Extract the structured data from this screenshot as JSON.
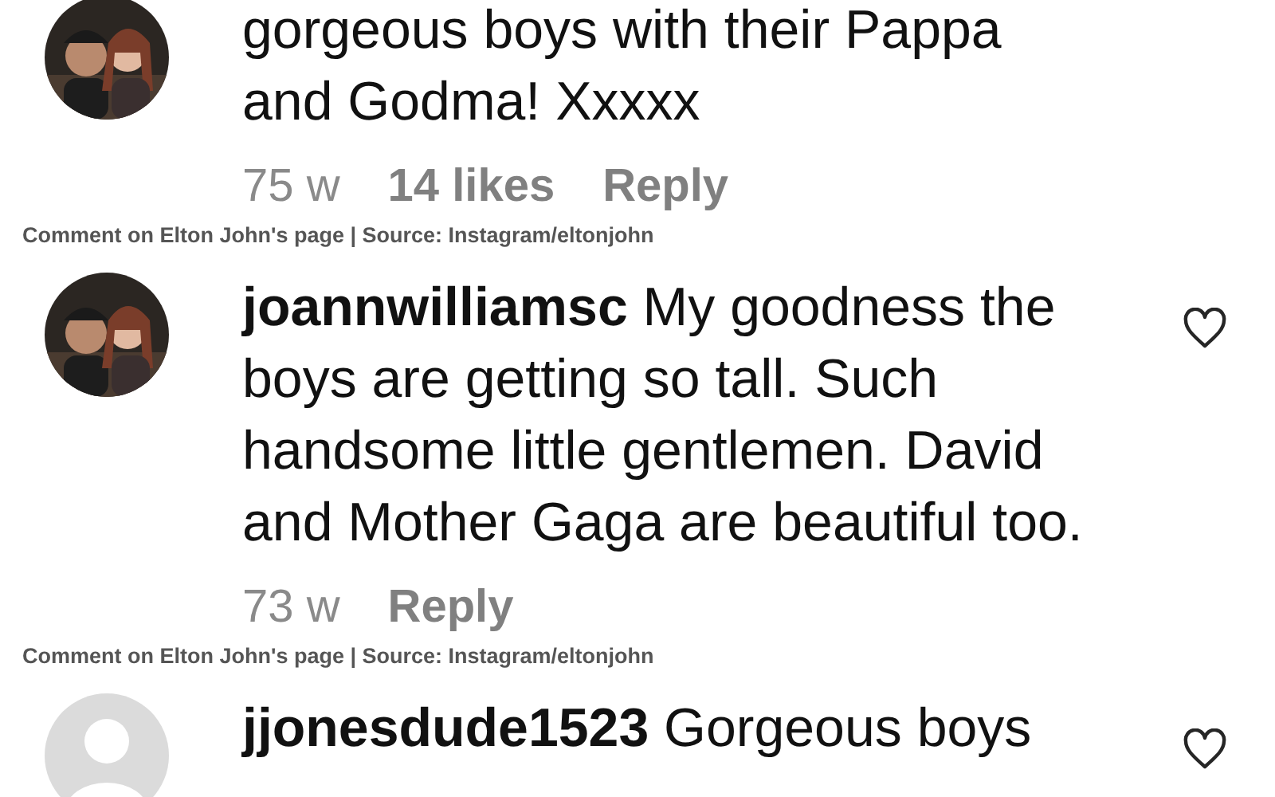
{
  "sections": [
    {
      "avatar": {
        "kind": "picture"
      },
      "lines": [
        "gorgeous boys with their Pappa",
        "and Godma! Xxxxx"
      ],
      "time": "75 w",
      "likes": "14 likes",
      "reply": "Reply",
      "caption": "Comment on Elton John's page | Source: Instagram/eltonjohn"
    },
    {
      "avatar": {
        "kind": "picture"
      },
      "like_button": true,
      "lines": [
        "**joannwilliamsc** My goodness the",
        "boys are getting so tall. Such",
        "handsome little gentlemen. David",
        "and Mother Gaga are beautiful too."
      ],
      "time": "73 w",
      "reply": "Reply",
      "caption": "Comment on Elton John's page | Source: Instagram/eltonjohn"
    },
    {
      "avatar": {
        "kind": "default"
      },
      "like_button": true,
      "lines": [
        "**jjonesdude1523** Gorgeous boys"
      ]
    }
  ]
}
